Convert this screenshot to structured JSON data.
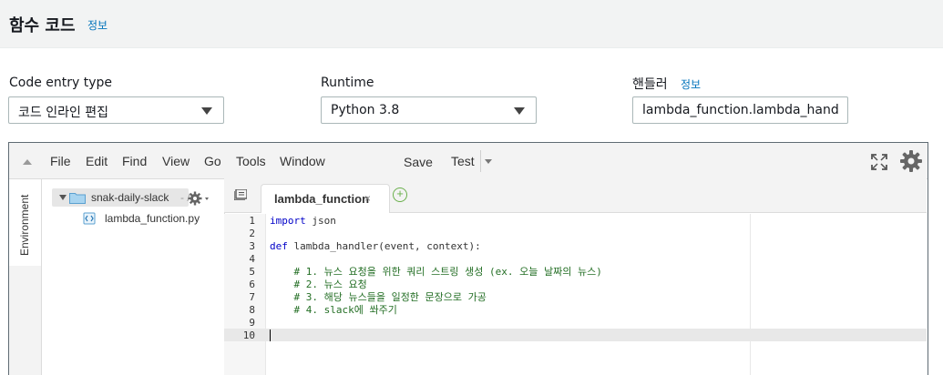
{
  "header": {
    "title": "함수 코드",
    "info_link": "정보"
  },
  "config": {
    "code_entry_type": {
      "label": "Code entry type",
      "value": "코드 인라인 편집"
    },
    "runtime": {
      "label": "Runtime",
      "value": "Python 3.8"
    },
    "handler": {
      "label": "핸들러",
      "info_link": "정보",
      "value": "lambda_function.lambda_handler"
    }
  },
  "ide": {
    "menu": [
      "File",
      "Edit",
      "Find",
      "View",
      "Go",
      "Tools",
      "Window"
    ],
    "save_label": "Save",
    "test_label": "Test",
    "environment_tab": "Environment",
    "tree": {
      "root": "snak-daily-slack",
      "root_suffix": "- /",
      "files": [
        "lambda_function.py"
      ]
    },
    "active_tab": {
      "label": "lambda_function",
      "close": "×"
    },
    "add_tab": "+",
    "line_numbers": [
      "1",
      "2",
      "3",
      "4",
      "5",
      "6",
      "7",
      "8",
      "9",
      "10"
    ],
    "code": {
      "l1_kw": "import",
      "l1_rest": " json",
      "l3_kw": "def",
      "l3_rest": " lambda_handler(event, context):",
      "l5": "    # 1. 뉴스 요청을 위한 쿼리 스트링 생성 (ex. 오늘 날짜의 뉴스)",
      "l6": "    # 2. 뉴스 요청",
      "l7": "    # 3. 해당 뉴스들을 일정한 문장으로 가공",
      "l8": "    # 4. slack에 쏴주기"
    }
  }
}
